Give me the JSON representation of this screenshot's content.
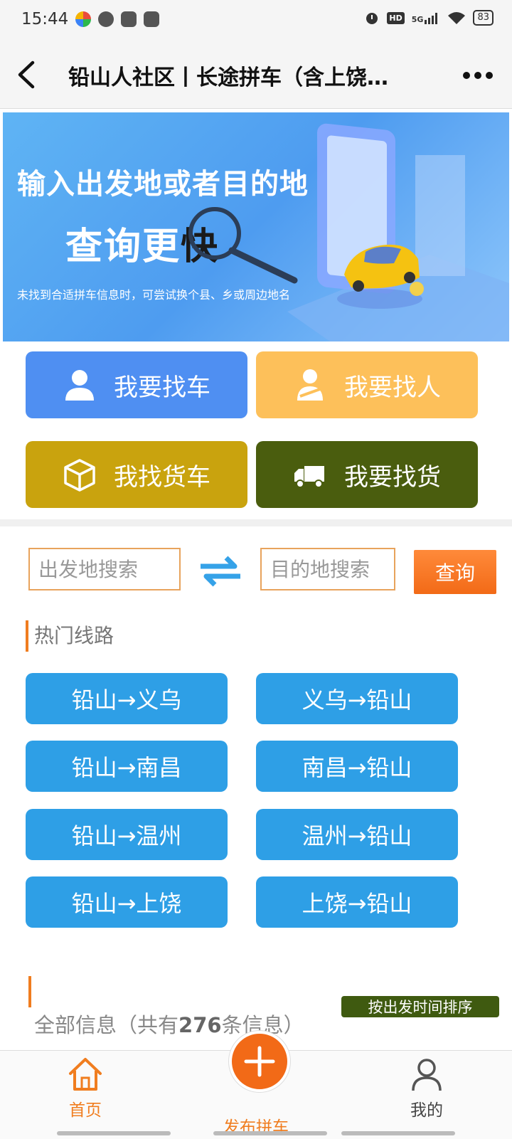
{
  "status_bar": {
    "time": "15:44",
    "network": "5G",
    "hd_badge": "HD",
    "battery": "83",
    "app_icons": [
      {
        "name": "pinwheel-icon",
        "color": "#e94b3c"
      },
      {
        "name": "wechat-icon",
        "color": "#555555"
      },
      {
        "name": "link-app-icon",
        "color": "#555555"
      },
      {
        "name": "inbox-icon",
        "color": "#555555"
      }
    ]
  },
  "nav": {
    "title": "铅山人社区丨长途拼车（含上饶…",
    "back_icon": "chevron-left-icon",
    "more_icon": "more-dots-icon"
  },
  "banner": {
    "line1": "输入出发地或者目的地",
    "line2_main": "查询更",
    "line2_highlight": "快",
    "note": "未找到合适拼车信息时，可尝试换个县、乡或周边地名"
  },
  "actions": [
    {
      "id": "btn-find-car",
      "label": "我要找车",
      "icon": "person-icon",
      "color": "#4f8ff2"
    },
    {
      "id": "btn-find-people",
      "label": "我要找人",
      "icon": "driver-icon",
      "color": "#fdc05a"
    },
    {
      "id": "btn-find-truck",
      "label": "我找货车",
      "icon": "box-icon",
      "color": "#c9a30e"
    },
    {
      "id": "btn-find-cargo",
      "label": "我要找货",
      "icon": "truck-icon",
      "color": "#4a5d0e"
    }
  ],
  "search": {
    "depart_placeholder": "出发地搜索",
    "dest_placeholder": "目的地搜索",
    "query_label": "查询"
  },
  "hot_routes": {
    "title": "热门线路",
    "routes": [
      "铅山→义乌",
      "义乌→铅山",
      "铅山→南昌",
      "南昌→铅山",
      "铅山→温州",
      "温州→铅山",
      "铅山→上饶",
      "上饶→铅山"
    ]
  },
  "all_info": {
    "prefix": "全部信息（共有",
    "count": "276",
    "suffix": "条信息）",
    "sort_label": "按出发时间排序"
  },
  "tabs": {
    "home": "首页",
    "publish": "发布拼车",
    "mine": "我的"
  },
  "colors": {
    "accent": "#f07d1f",
    "route_blue": "#2e9fe6"
  }
}
